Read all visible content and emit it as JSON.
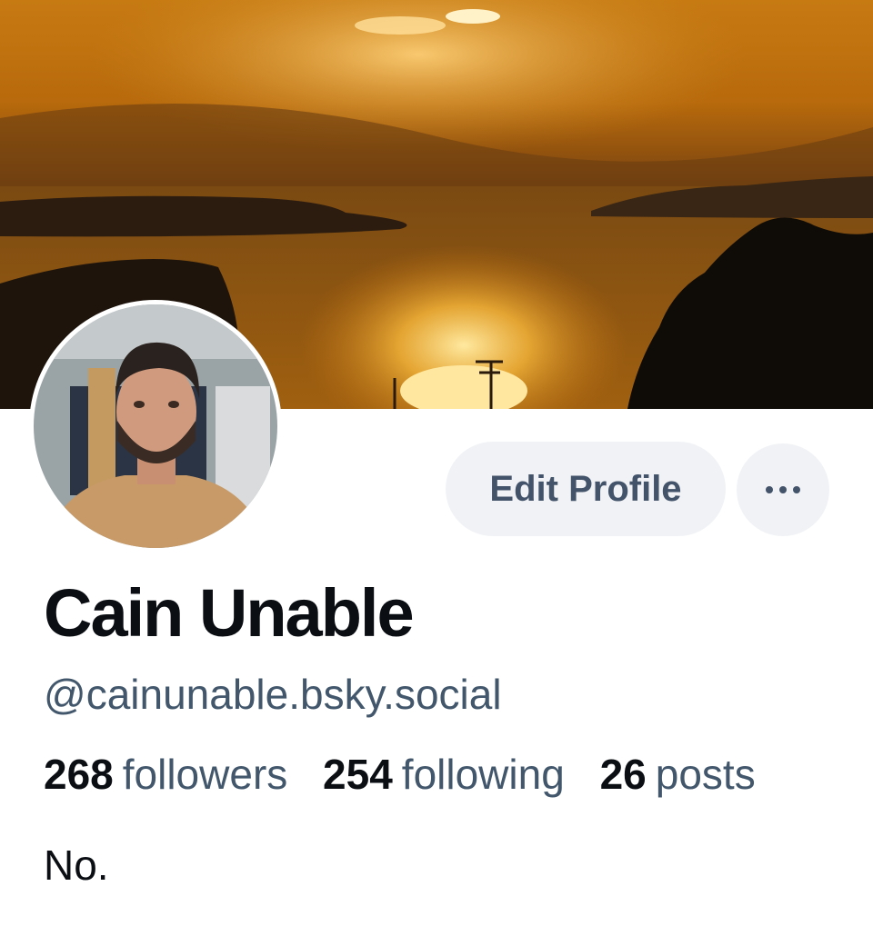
{
  "profile": {
    "banner_icon": "sunset-banner-image",
    "avatar_icon": "profile-avatar-image",
    "display_name": "Cain Unable",
    "handle": "@cainunable.bsky.social",
    "bio": "No."
  },
  "actions": {
    "edit_label": "Edit Profile",
    "more_icon": "more-options-icon"
  },
  "stats": {
    "followers_count": "268",
    "followers_label": "followers",
    "following_count": "254",
    "following_label": "following",
    "posts_count": "26",
    "posts_label": "posts"
  },
  "colors": {
    "button_bg": "#f0f2f5",
    "button_text": "#43536a",
    "muted_text": "#42576c",
    "primary_text": "#0b0f14"
  }
}
